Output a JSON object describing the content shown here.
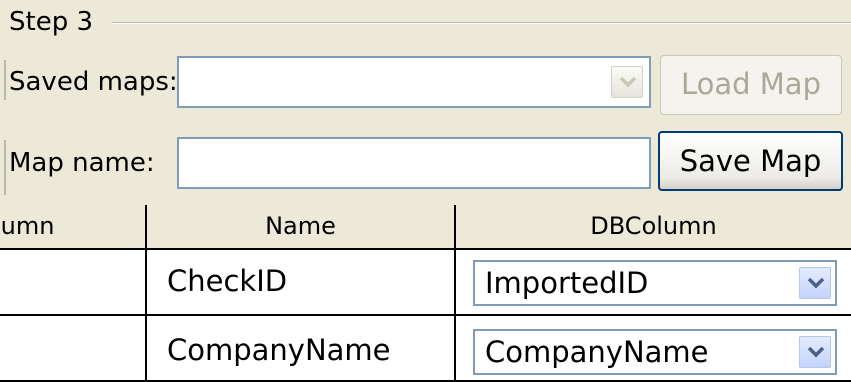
{
  "step3": {
    "group_title": "Step 3",
    "saved_maps_label": "Saved maps:",
    "saved_maps_value": "",
    "map_name_label": "Map name:",
    "map_name_value": "",
    "load_map_label": "Load Map",
    "save_map_label": "Save Map"
  },
  "grid": {
    "columns": [
      "lumn",
      "Name",
      "DBColumn"
    ],
    "rows": [
      {
        "source": "",
        "name": "CheckID",
        "db_column": "ImportedID"
      },
      {
        "source": "",
        "name": "CompanyName",
        "db_column": "CompanyName"
      }
    ]
  },
  "icons": {
    "dropdown_disabled": "chevron-down-icon",
    "dropdown": "chevron-down-icon"
  },
  "colors": {
    "window_bg": "#ece9d8",
    "input_border": "#7f9db9",
    "dropdown_arrow": "#4d6185",
    "disabled_text": "#aca899",
    "default_button_border": "#003c74"
  }
}
